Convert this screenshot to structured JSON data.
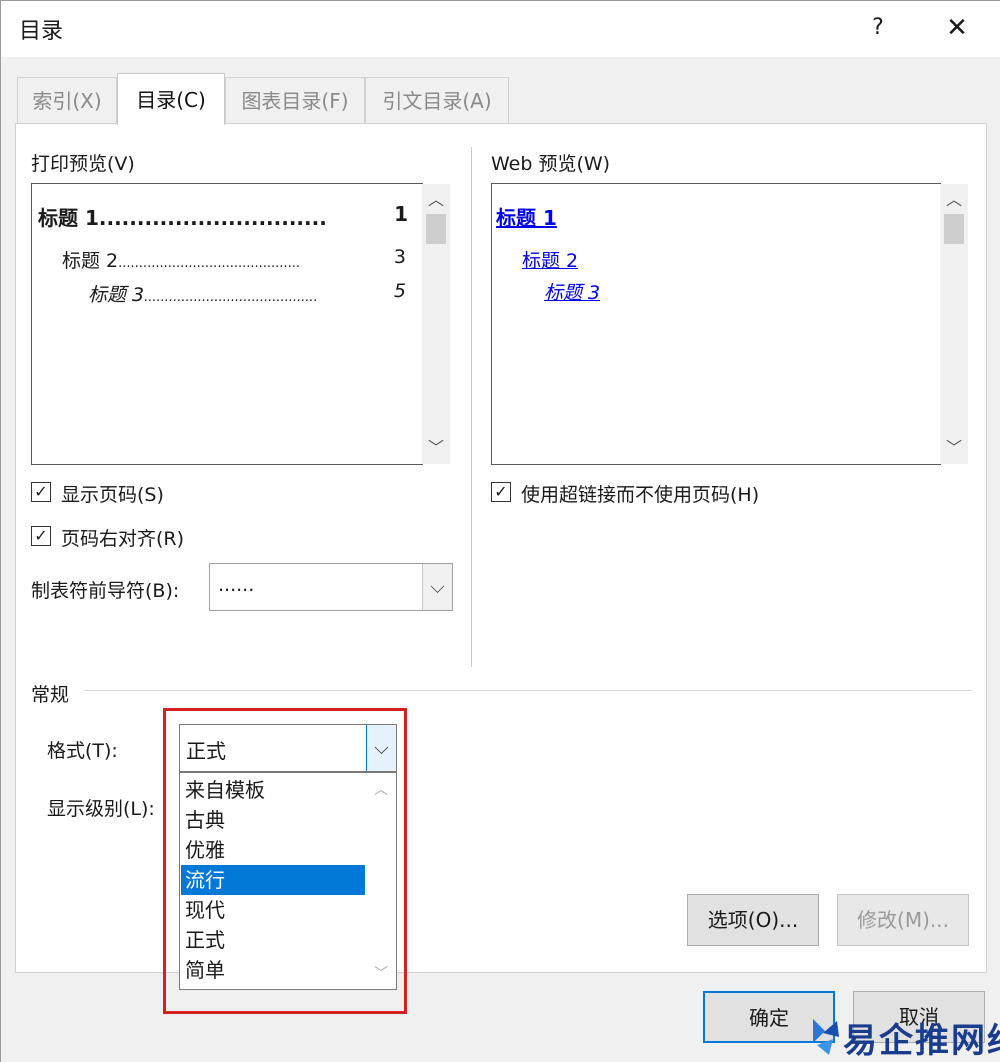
{
  "window": {
    "title": "目录",
    "help_label": "?",
    "close_label": "✕"
  },
  "tabs": [
    {
      "label": "索引(X)",
      "active": false
    },
    {
      "label": "目录(C)",
      "active": true
    },
    {
      "label": "图表目录(F)",
      "active": false
    },
    {
      "label": "引文目录(A)",
      "active": false
    }
  ],
  "print_preview": {
    "label": "打印预览(V)",
    "lines": [
      {
        "text": "标题 1",
        "leader": "..............................",
        "page": "1"
      },
      {
        "text": "标题 2",
        "leader": "............................................",
        "page": "3"
      },
      {
        "text": "标题 3",
        "leader": "..........................................",
        "page": "5"
      }
    ]
  },
  "web_preview": {
    "label": "Web 预览(W)",
    "lines": [
      "标题 1",
      "标题 2",
      "标题 3"
    ]
  },
  "options": {
    "show_page_numbers": {
      "label": "显示页码(S)",
      "checked": true
    },
    "right_align": {
      "label": "页码右对齐(R)",
      "checked": true
    },
    "use_hyperlinks": {
      "label": "使用超链接而不使用页码(H)",
      "checked": true
    },
    "tab_leader": {
      "label": "制表符前导符(B):",
      "value": "......"
    }
  },
  "general": {
    "section_label": "常规",
    "format_label": "格式(T):",
    "format_value": "正式",
    "format_options": [
      "来自模板",
      "古典",
      "优雅",
      "流行",
      "现代",
      "正式",
      "简单"
    ],
    "format_selected": "流行",
    "levels_label": "显示级别(L):"
  },
  "buttons": {
    "options": "选项(O)...",
    "modify": "修改(M)...",
    "ok": "确定",
    "cancel": "取消"
  },
  "watermark": {
    "text": "易企推网络"
  },
  "colors": {
    "accent": "#0078d7",
    "highlight_box": "#d42020",
    "link": "#0000ee"
  }
}
